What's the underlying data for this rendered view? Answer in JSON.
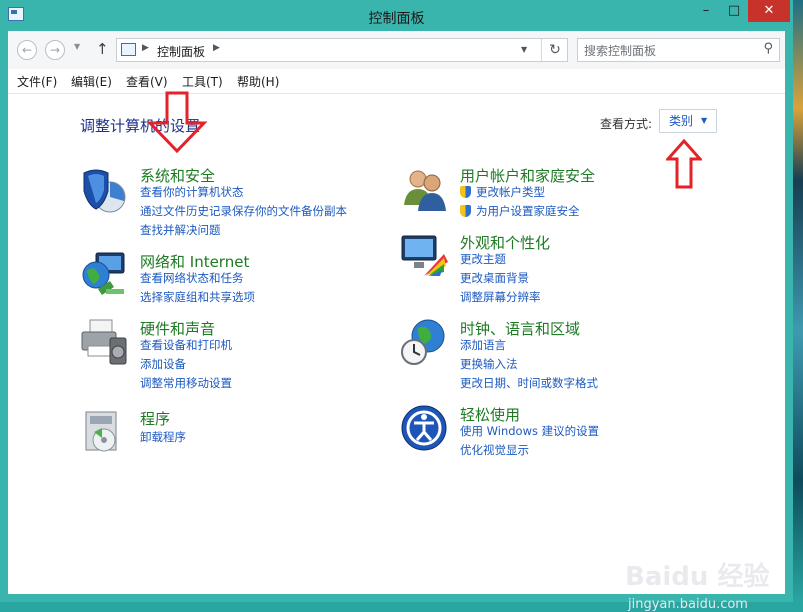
{
  "window": {
    "title": "控制面板"
  },
  "nav": {
    "crumb": "控制面板",
    "search_placeholder": "搜索控制面板"
  },
  "menu": {
    "items": [
      "文件(F)",
      "编辑(E)",
      "查看(V)",
      "工具(T)",
      "帮助(H)"
    ]
  },
  "main": {
    "heading": "调整计算机的设置",
    "view_by_label": "查看方式:",
    "view_by_value": "类别"
  },
  "categories": [
    {
      "title": "系统和安全",
      "links": [
        "查看你的计算机状态",
        "通过文件历史记录保存你的文件备份副本",
        "查找并解决问题"
      ]
    },
    {
      "title": "网络和 Internet",
      "links": [
        "查看网络状态和任务",
        "选择家庭组和共享选项"
      ]
    },
    {
      "title": "硬件和声音",
      "links": [
        "查看设备和打印机",
        "添加设备",
        "调整常用移动设置"
      ]
    },
    {
      "title": "程序",
      "links": [
        "卸载程序"
      ]
    },
    {
      "title": "用户帐户和家庭安全",
      "links": [
        "更改帐户类型",
        "为用户设置家庭安全"
      ]
    },
    {
      "title": "外观和个性化",
      "links": [
        "更改主题",
        "更改桌面背景",
        "调整屏幕分辨率"
      ]
    },
    {
      "title": "时钟、语言和区域",
      "links": [
        "添加语言",
        "更换输入法",
        "更改日期、时间或数字格式"
      ]
    },
    {
      "title": "轻松使用",
      "links": [
        "使用 Windows 建议的设置",
        "优化视觉显示"
      ]
    }
  ],
  "watermark": {
    "logo": "Baidu 经验",
    "url": "jingyan.baidu.com"
  },
  "colors": {
    "window_frame": "#3ab5ae",
    "close_button": "#c7332a",
    "category_title": "#1e7a23",
    "link": "#1c5ac1",
    "heading": "#1e3287",
    "annotation_arrow": "#e3232a"
  },
  "icons": {
    "title_bar": [
      "control-panel-icon",
      "minimize-icon",
      "maximize-icon",
      "close-icon"
    ],
    "categories": [
      "security-shield-icon",
      "network-globe-icon",
      "printer-icon",
      "programs-box-icon",
      "users-icon",
      "display-palette-icon",
      "clock-globe-icon",
      "accessibility-icon"
    ]
  }
}
